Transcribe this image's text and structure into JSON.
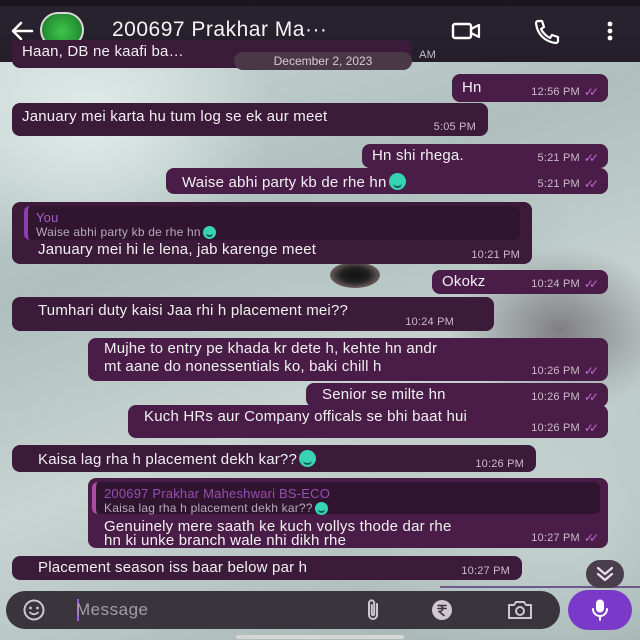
{
  "header": {
    "contact_name": "200697 Prakhar Ma···",
    "icons": [
      "back-arrow-icon",
      "video-call-icon",
      "phone-icon",
      "more-vert-icon"
    ]
  },
  "date_chip": "December 2, 2023",
  "partial_top_message": "Haan, DB ne kaafi ba…",
  "partial_top_time": "AM",
  "messages": [
    {
      "text": "Hn",
      "time": "12:56 PM"
    },
    {
      "text": "January mei karta hu tum log se ek aur meet",
      "time": "5:05 PM"
    },
    {
      "text": "Hn shi rhega.",
      "time": "5:21 PM"
    },
    {
      "text": "Waise abhi party kb de rhe hn",
      "time": "5:21 PM"
    },
    {
      "quote_author": "You",
      "quote_text": "Waise abhi party kb de rhe hn",
      "text": "January mei hi le lena, jab karenge meet",
      "time": "10:21 PM"
    },
    {
      "text": "Okokz",
      "time": "10:24 PM"
    },
    {
      "text": "Tumhari duty kaisi Jaa rhi h placement mei??",
      "time": "10:24 PM"
    },
    {
      "line1": "Mujhe to entry pe khada kr dete h, kehte hn andr",
      "line2": "mt aane do nonessentials ko, baki chill h",
      "time": "10:26 PM"
    },
    {
      "text": "Senior se milte hn",
      "time": "10:26 PM"
    },
    {
      "text": "Kuch HRs aur Company officals se bhi baat hui",
      "time": "10:26 PM"
    },
    {
      "text": "Kaisa lag rha h placement dekh kar??",
      "time": "10:26 PM"
    },
    {
      "quote_author": "200697 Prakhar Maheshwari BS-ECO",
      "quote_text": "Kaisa lag rha h placement dekh kar??",
      "line1": "Genuinely mere saath ke kuch vollys thode dar rhe",
      "line2": "hn ki unke branch wale nhi dikh rhe",
      "time": "10:27 PM"
    },
    {
      "text": "Placement season iss baar below par h",
      "time": "10:27 PM"
    }
  ],
  "input": {
    "placeholder": "Message",
    "icons": [
      "emoji-icon",
      "attach-icon",
      "rupee-payment-icon",
      "camera-icon",
      "mic-icon"
    ]
  },
  "colors": {
    "bubble": "#3c1a3a",
    "tick": "#c06bd8",
    "mic": "#7a39c9"
  }
}
